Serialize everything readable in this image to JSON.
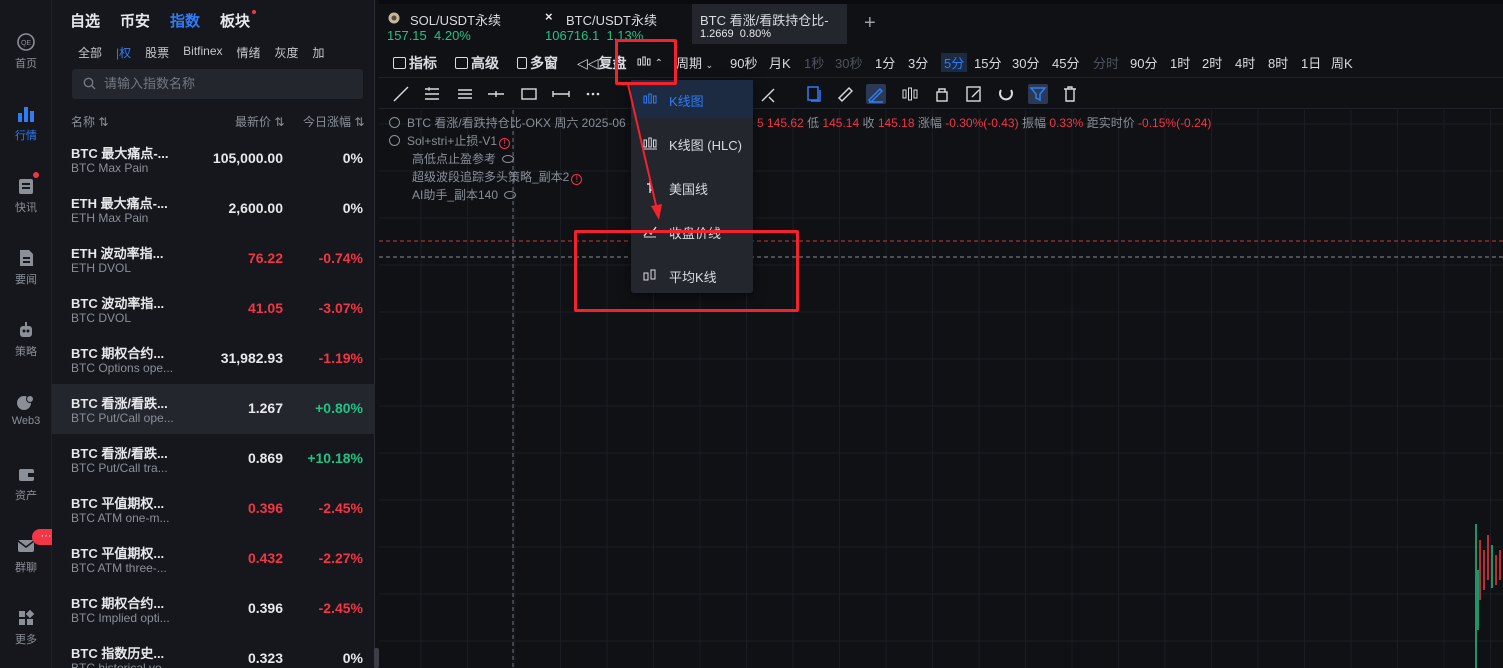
{
  "nav": [
    {
      "label": "首页",
      "icon": "home-icon"
    },
    {
      "label": "行情",
      "icon": "market-icon"
    },
    {
      "label": "快讯",
      "icon": "news-flash-icon"
    },
    {
      "label": "要闻",
      "icon": "headlines-icon"
    },
    {
      "label": "策略",
      "icon": "strategy-robot-icon"
    },
    {
      "label": "Web3",
      "icon": "web3-icon"
    },
    {
      "label": "资产",
      "icon": "wallet-icon"
    },
    {
      "label": "群聊",
      "icon": "chat-icon"
    },
    {
      "label": "更多",
      "icon": "more-grid-icon"
    }
  ],
  "nav_badge": "···",
  "categories": [
    "自选",
    "币安",
    "指数",
    "板块"
  ],
  "subcategories": [
    "全部",
    "|权",
    "股票",
    "Bitfinex",
    "情绪",
    "灰度",
    "加"
  ],
  "search": {
    "placeholder": "请输入指数名称"
  },
  "columns": {
    "name": "名称",
    "price": "最新价",
    "change": "今日涨幅"
  },
  "rows": [
    {
      "name": "BTC 最大痛点-...",
      "sub": "BTC Max Pain",
      "price": "105,000.00",
      "change": "0%",
      "price_color": "white",
      "change_color": "white"
    },
    {
      "name": "ETH 最大痛点-...",
      "sub": "ETH Max Pain",
      "price": "2,600.00",
      "change": "0%",
      "price_color": "white",
      "change_color": "white"
    },
    {
      "name": "ETH 波动率指...",
      "sub": "ETH DVOL",
      "price": "76.22",
      "change": "-0.74%",
      "price_color": "red",
      "change_color": "red"
    },
    {
      "name": "BTC 波动率指...",
      "sub": "BTC DVOL",
      "price": "41.05",
      "change": "-3.07%",
      "price_color": "red",
      "change_color": "red"
    },
    {
      "name": "BTC 期权合约...",
      "sub": "BTC Options ope...",
      "price": "31,982.93",
      "change": "-1.19%",
      "price_color": "white",
      "change_color": "red"
    },
    {
      "name": "BTC 看涨/看跌...",
      "sub": "BTC Put/Call ope...",
      "price": "1.267",
      "change": "+0.80%",
      "price_color": "white",
      "change_color": "green"
    },
    {
      "name": "BTC 看涨/看跌...",
      "sub": "BTC Put/Call tra...",
      "price": "0.869",
      "change": "+10.18%",
      "price_color": "white",
      "change_color": "green"
    },
    {
      "name": "BTC 平值期权...",
      "sub": "BTC ATM one-m...",
      "price": "0.396",
      "change": "-2.45%",
      "price_color": "red",
      "change_color": "red"
    },
    {
      "name": "BTC 平值期权...",
      "sub": "BTC ATM three-...",
      "price": "0.432",
      "change": "-2.27%",
      "price_color": "red",
      "change_color": "red"
    },
    {
      "name": "BTC 期权合约...",
      "sub": "BTC Implied opti...",
      "price": "0.396",
      "change": "-2.45%",
      "price_color": "white",
      "change_color": "red"
    },
    {
      "name": "BTC 指数历史...",
      "sub": "BTC historical vo...",
      "price": "0.323",
      "change": "0%",
      "price_color": "white",
      "change_color": "white"
    }
  ],
  "chart_tabs": [
    {
      "title": "SOL/USDT永续",
      "price": "157.15",
      "pct": "4.20%",
      "icon": "sol-coin-icon"
    },
    {
      "title": "BTC/USDT永续",
      "price": "106716.1",
      "pct": "1.13%",
      "icon": "close-icon"
    },
    {
      "title": "BTC 看涨/看跌持仓比-",
      "price": "1.2669",
      "pct": "0.80%"
    }
  ],
  "add_tab": "+",
  "toolbar": {
    "indicator": "指标",
    "advanced": "高级",
    "multi_window": "多窗",
    "replay": "复盘",
    "period": "周期",
    "intervals": [
      "90秒",
      "月K",
      "1秒",
      "30秒",
      "1分",
      "3分",
      "5分",
      "15分",
      "30分",
      "45分",
      "分时",
      "90分",
      "1时",
      "2时",
      "4时",
      "8时",
      "1日",
      "周K"
    ],
    "active_interval": "5分",
    "disabled_intervals": [
      "1秒",
      "30秒",
      "分时"
    ]
  },
  "legend": {
    "title": "BTC 看涨/看跌持仓比-OKX  周六 2025-06",
    "ohlc_tail": "5 145.62",
    "low_label": "低",
    "low": "145.14",
    "close_label": "收",
    "close": "145.18",
    "change_label": "涨幅",
    "change": "-0.30%(-0.43)",
    "amp_label": "振幅",
    "amp": "0.33%",
    "dist_label": "距实时价",
    "dist": "-0.15%(-0.24)",
    "strategies": [
      "Sol+stri+止损-V1",
      "高低点止盈参考",
      "超级波段追踪多头策略_副本2",
      "AI助手_副本140"
    ]
  },
  "dropdown": {
    "items": [
      {
        "label": "K线图",
        "icon": "candlestick-icon"
      },
      {
        "label": "K线图 (HLC)",
        "icon": "candlestick-hlc-icon"
      },
      {
        "label": "美国线",
        "icon": "ohlc-bar-icon"
      },
      {
        "label": "收盘价线",
        "icon": "line-chart-icon"
      },
      {
        "label": "平均K线",
        "icon": "heikin-ashi-icon"
      }
    ],
    "selected": "K线图"
  },
  "colors": {
    "accent": "#2f7cf6",
    "up": "#1fc484",
    "down": "#f23645",
    "annotation": "#f5222d"
  }
}
